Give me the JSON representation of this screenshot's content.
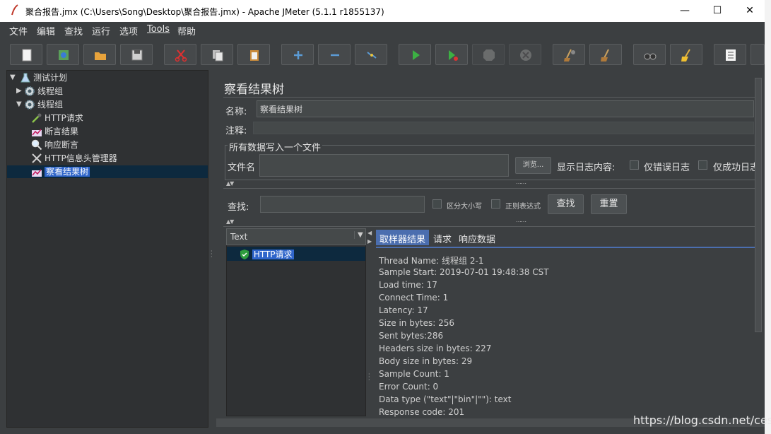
{
  "window": {
    "title": "聚合报告.jmx (C:\\Users\\Song\\Desktop\\聚合报告.jmx) - Apache JMeter (5.1.1 r1855137)",
    "minimize": "—",
    "maximize": "☐",
    "close": "✕"
  },
  "menu": [
    "文件",
    "编辑",
    "查找",
    "运行",
    "选项",
    "Tools",
    "帮助"
  ],
  "toolbar": [
    "new",
    "templates",
    "open",
    "save",
    "cut",
    "copy",
    "paste",
    "expand",
    "collapse",
    "toggle",
    "start",
    "start-no-pause",
    "stop",
    "shutdown",
    "clear",
    "clear-all",
    "search",
    "reset-search",
    "function-helper"
  ],
  "tree": {
    "root": "测试计划",
    "items": [
      "线程组",
      "线程组",
      "HTTP请求",
      "断言结果",
      "响应断言",
      "HTTP信息头管理器",
      "察看结果树"
    ]
  },
  "panel": {
    "title": "察看结果树",
    "name_label": "名称:",
    "name_value": "察看结果树",
    "comment_label": "注释:",
    "group_title": "所有数据写入一个文件",
    "file_label": "文件名",
    "browse": "浏览...",
    "log_label": "显示日志内容:",
    "errors_only": "仅错误日志",
    "success_only": "仅成功日志",
    "search_label": "查找:",
    "case_sensitive": "区分大小写",
    "regex": "正则表达式",
    "search_btn": "查找",
    "reset_btn": "重置"
  },
  "results": {
    "renderer": "Text",
    "list": [
      "HTTP请求"
    ],
    "tabs": [
      "取样器结果",
      "请求",
      "响应数据"
    ],
    "lines": [
      "Thread Name: 线程组 2-1",
      "Sample Start: 2019-07-01 19:48:38 CST",
      "Load time: 17",
      "Connect Time: 1",
      "Latency: 17",
      "Size in bytes: 256",
      "Sent bytes:286",
      "Headers size in bytes: 227",
      "Body size in bytes: 29",
      "Sample Count: 1",
      "Error Count: 0",
      "Data type (\"text\"|\"bin\"|\"\"): text",
      "Response code: 201"
    ]
  },
  "watermark": "https://blog.csdn.net/cesor",
  "colors": {
    "selection": "#2f65ca",
    "tab_active": "#4b6eaf",
    "background": "#3c3f41"
  }
}
